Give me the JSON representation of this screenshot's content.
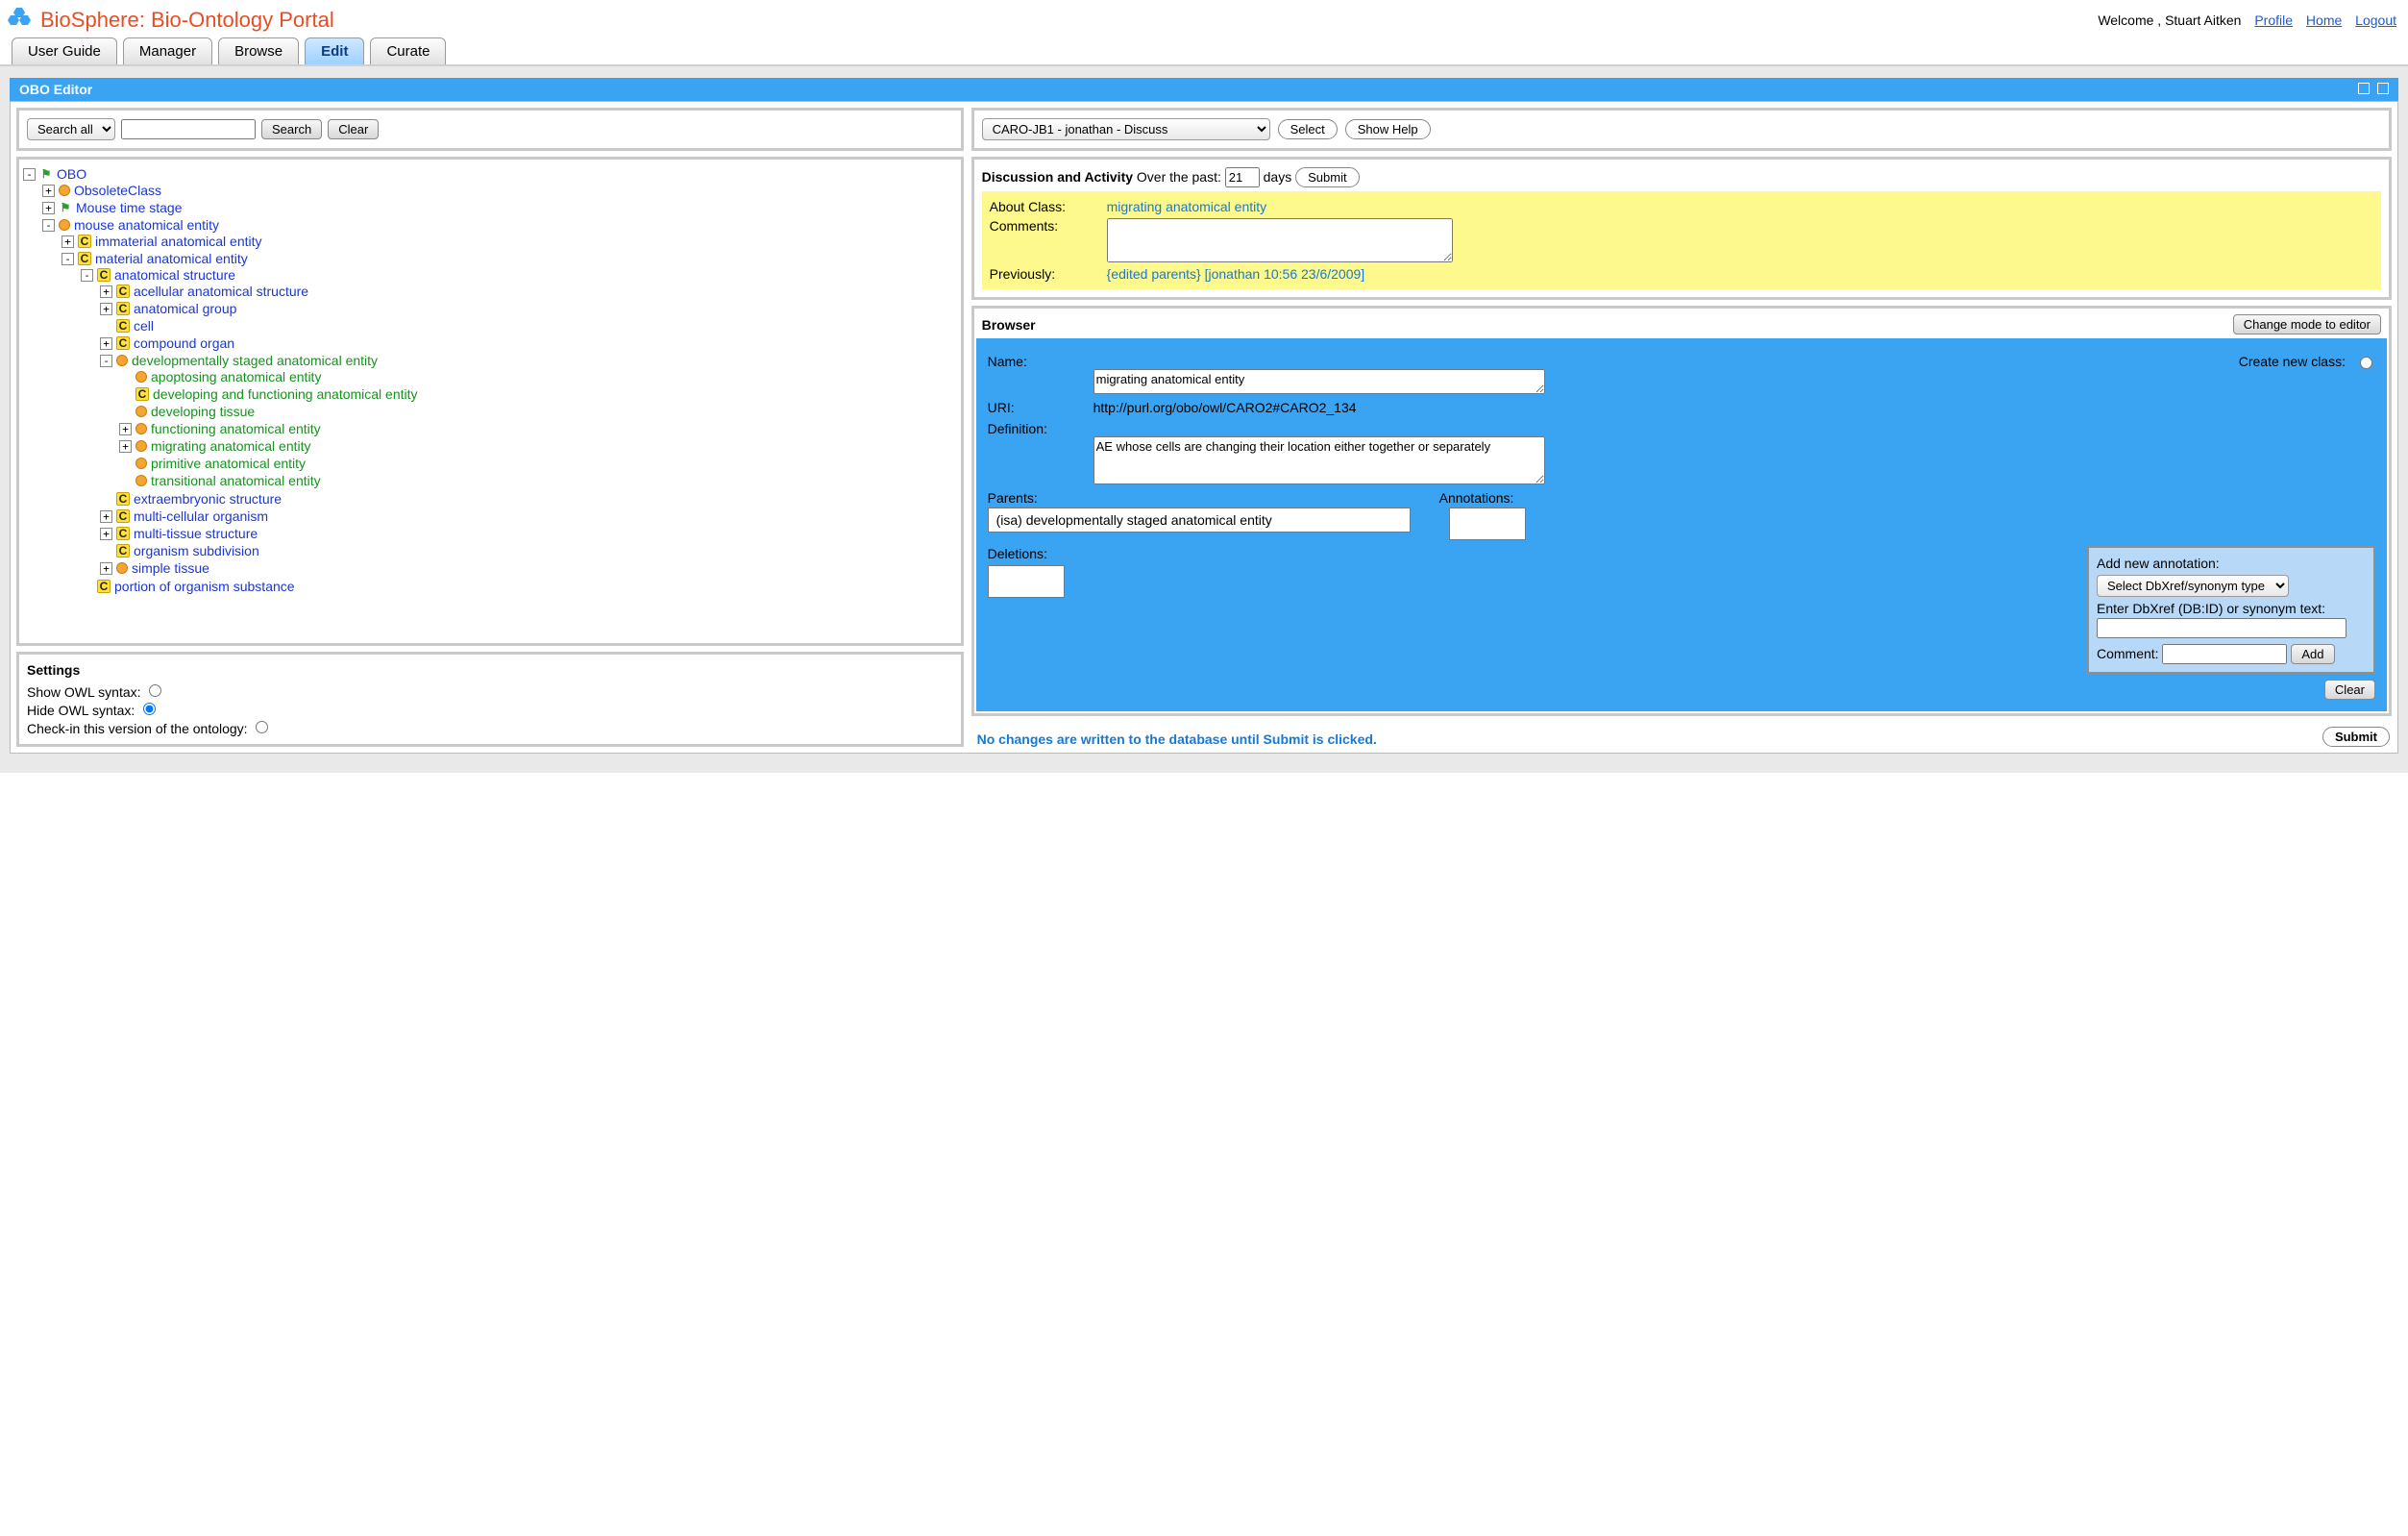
{
  "brand": {
    "title": "BioSphere: Bio-Ontology Portal"
  },
  "user": {
    "welcome": "Welcome , Stuart Aitken",
    "links": {
      "profile": "Profile",
      "home": "Home",
      "logout": "Logout"
    }
  },
  "tabs": {
    "userguide": "User Guide",
    "manager": "Manager",
    "browse": "Browse",
    "edit": "Edit",
    "curate": "Curate"
  },
  "panel": {
    "title": "OBO Editor"
  },
  "search": {
    "scope_selected": "Search all",
    "search_btn": "Search",
    "clear_btn": "Clear"
  },
  "tree": {
    "root": "OBO",
    "n": {
      "obsolete": "ObsoleteClass",
      "mousetime": "Mouse time stage",
      "mouseanat": "mouse anatomical entity",
      "immaterial": "immaterial anatomical entity",
      "material": "material anatomical entity",
      "anatstruct": "anatomical structure",
      "acellular": "acellular anatomical structure",
      "anatgroup": "anatomical group",
      "cell": "cell",
      "compound": "compound organ",
      "devstaged": "developmentally staged anatomical entity",
      "apoptosing": "apoptosing anatomical entity",
      "devfunc": "developing and functioning anatomical entity",
      "devtissue": "developing tissue",
      "functioning": "functioning anatomical entity",
      "migrating": "migrating anatomical entity",
      "primitive": "primitive anatomical entity",
      "transitional": "transitional anatomical entity",
      "extraemb": "extraembryonic structure",
      "multicell": "multi-cellular organism",
      "multitissue": "multi-tissue structure",
      "orgsub": "organism subdivision",
      "simpletissue": "simple tissue",
      "portion": "portion of organism substance"
    }
  },
  "settings": {
    "header": "Settings",
    "showowl": "Show OWL syntax:",
    "hideowl": "Hide OWL syntax:",
    "checkin": "Check-in this version of the ontology:"
  },
  "topright": {
    "dropdown_selected": "CARO-JB1 - jonathan - Discuss",
    "select_btn": "Select",
    "help_btn": "Show Help"
  },
  "discussion": {
    "title_bold": "Discussion and Activity",
    "title_rest": " Over the past:",
    "days_value": "21",
    "days_label": " days",
    "submit": "Submit",
    "aboutclass_label": "About Class:",
    "aboutclass_value": "migrating anatomical entity",
    "comments_label": "Comments:",
    "previously_label": "Previously:",
    "previously_value": "{edited parents} [jonathan 10:56 23/6/2009]"
  },
  "browser": {
    "heading": "Browser",
    "changemode": "Change mode to editor",
    "name_label": "Name:",
    "createnew": "Create new class:",
    "name_value": "migrating anatomical entity",
    "uri_label": "URI:",
    "uri_value": "http://purl.org/obo/owl/CARO2#CARO2_134",
    "definition_label": "Definition:",
    "definition_value": "AE whose cells are changing their location either together or separately",
    "parents_label": "Parents:",
    "parents_value": "(isa) developmentally staged anatomical entity",
    "annotations_label": "Annotations:",
    "deletions_label": "Deletions:",
    "addann_label": "Add new annotation:",
    "addann_select": "Select DbXref/synonym type",
    "enterdbxref": "Enter DbXref (DB:ID) or synonym text:",
    "comment_label": "Comment:",
    "add_btn": "Add",
    "clear_btn": "Clear"
  },
  "footer": {
    "note": "No changes are written to the database until Submit is clicked.",
    "submit": "Submit"
  }
}
